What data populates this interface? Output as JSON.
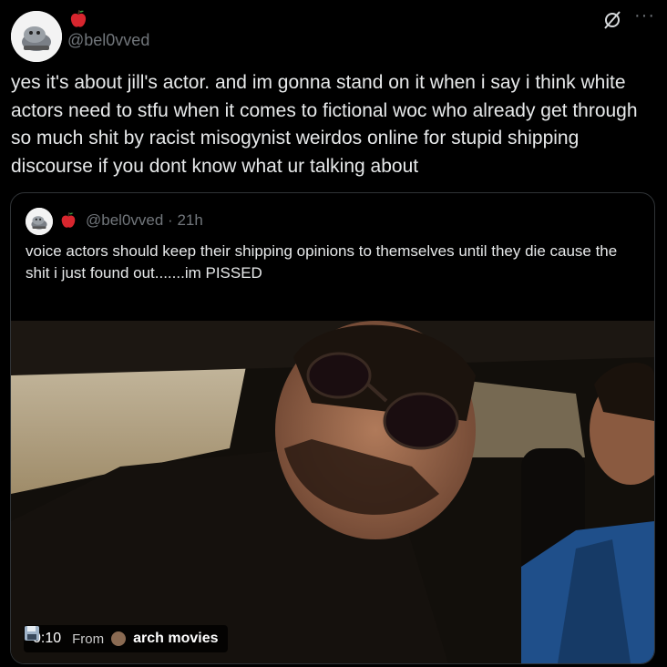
{
  "author": {
    "handle": "@bel0vved",
    "avatar_icon": "cartoon-avatar-icon",
    "badge_icon": "apple-emoji-icon"
  },
  "actions": {
    "grok_icon": "grok-icon",
    "more_label": "···"
  },
  "tweet": {
    "text": "yes it's about jill's actor. and im gonna stand on it when i say i think white actors need to stfu when it comes to fictional woc who already get through so much shit by racist misogynist weirdos online for stupid shipping discourse if you dont know what ur talking about"
  },
  "quoted": {
    "handle": "@bel0vved",
    "separator": "·",
    "time": "21h",
    "text": "voice actors should keep their shipping opinions to themselves until they die cause the shit i just found out.......im PISSED",
    "video": {
      "timestamp": "0:10",
      "from_label": "From",
      "source_name": "arch movies",
      "source_emoji": "floppy-disk-icon"
    }
  },
  "colors": {
    "text": "#e7e9ea",
    "secondary": "#71767b",
    "border": "#2f3336",
    "background": "#000000"
  }
}
